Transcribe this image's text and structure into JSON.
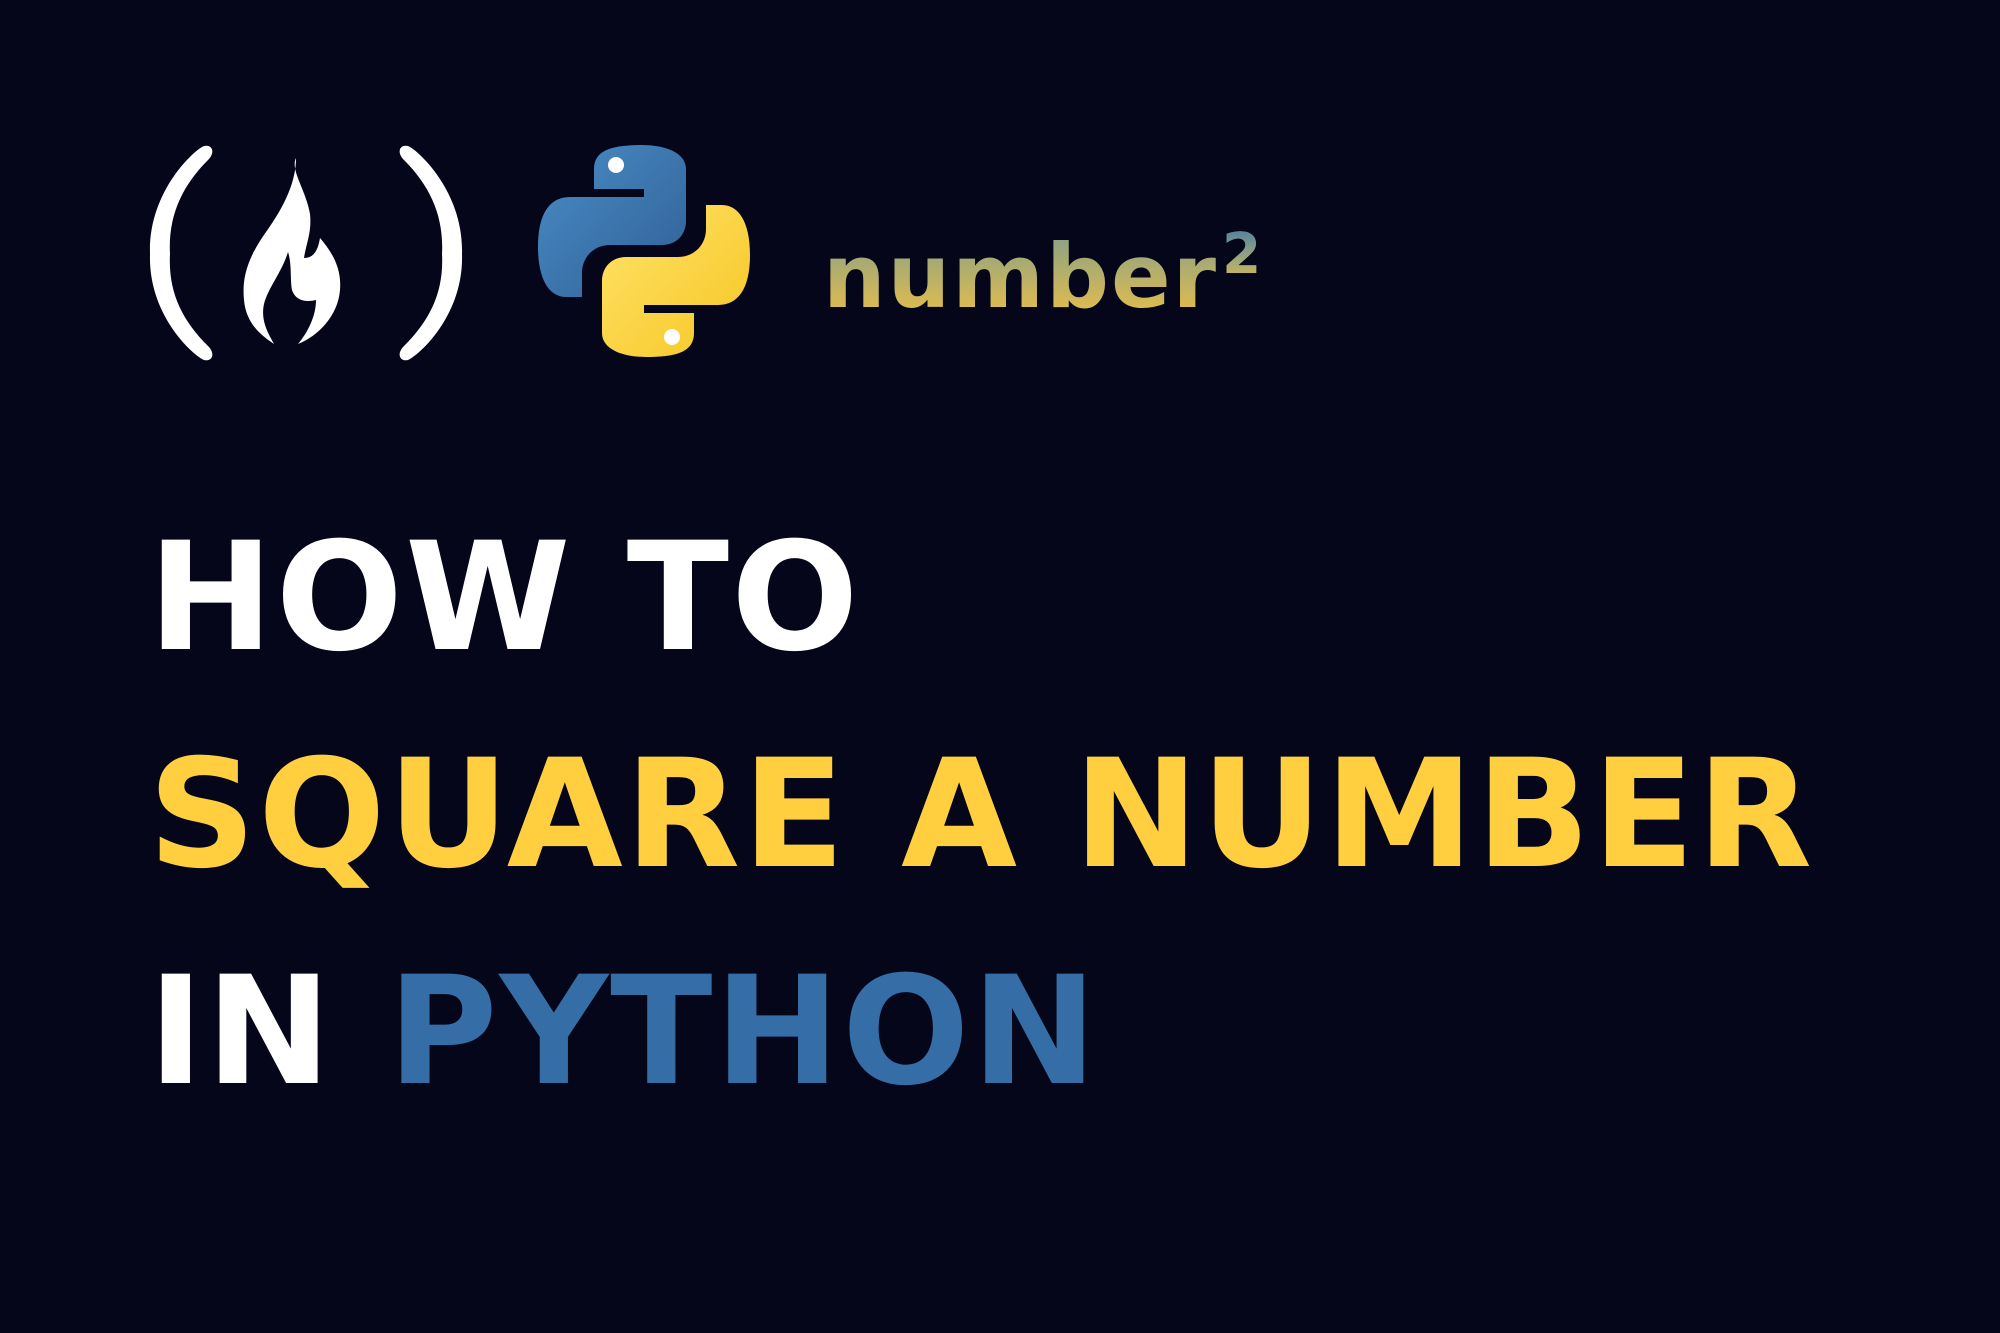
{
  "logos": {
    "fcc_icon": "freecodecamp-flame-icon",
    "python_icon": "python-logo-icon"
  },
  "formula": {
    "base": "number",
    "exponent": "2"
  },
  "headline": {
    "line1": "HOW TO",
    "line2": "SQUARE A NUMBER",
    "line3_part1": "IN",
    "line3_part2": "PYTHON"
  },
  "colors": {
    "background": "#05061a",
    "white": "#ffffff",
    "yellow": "#ffcf3f",
    "blue": "#356ea6"
  }
}
